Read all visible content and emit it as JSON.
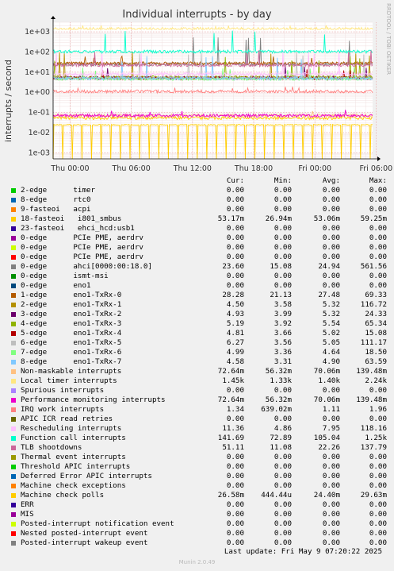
{
  "chart_data": {
    "type": "line",
    "title": "Individual interrupts - by day",
    "ylabel": "interrupts / second",
    "side_label": "RRDTOOL / TOBI OETIKER",
    "y_scale": "log",
    "ylim": [
      0.0005,
      3000
    ],
    "y_ticks": [
      "1e+03",
      "1e+02",
      "1e+01",
      "1e+00",
      "1e-01",
      "1e-02",
      "1e-03"
    ],
    "x_ticks": [
      "Thu 00:00",
      "Thu 06:00",
      "Thu 12:00",
      "Thu 18:00",
      "Fri 00:00",
      "Fri 06:00"
    ],
    "grid": true,
    "legend_columns": [
      "Cur:",
      "Min:",
      "Avg:",
      "Max:"
    ],
    "series": [
      {
        "name": "2-edge      timer",
        "color": "#00cc00",
        "cur": "0.00",
        "min": "0.00",
        "avg": "0.00",
        "max": "0.00"
      },
      {
        "name": "8-edge      rtc0",
        "color": "#0066b3",
        "cur": "0.00",
        "min": "0.00",
        "avg": "0.00",
        "max": "0.00"
      },
      {
        "name": "9-fasteoi   acpi",
        "color": "#ff8000",
        "cur": "0.00",
        "min": "0.00",
        "avg": "0.00",
        "max": "0.00"
      },
      {
        "name": "18-fasteoi   i801_smbus",
        "color": "#ffcc00",
        "cur": "53.17m",
        "min": "26.94m",
        "avg": "53.06m",
        "max": "59.25m"
      },
      {
        "name": "23-fasteoi   ehci_hcd:usb1",
        "color": "#330099",
        "cur": "0.00",
        "min": "0.00",
        "avg": "0.00",
        "max": "0.00"
      },
      {
        "name": "0-edge      PCIe PME, aerdrv",
        "color": "#990099",
        "cur": "0.00",
        "min": "0.00",
        "avg": "0.00",
        "max": "0.00"
      },
      {
        "name": "0-edge      PCIe PME, aerdrv",
        "color": "#ccff00",
        "cur": "0.00",
        "min": "0.00",
        "avg": "0.00",
        "max": "0.00"
      },
      {
        "name": "0-edge      PCIe PME, aerdrv",
        "color": "#ff0000",
        "cur": "0.00",
        "min": "0.00",
        "avg": "0.00",
        "max": "0.00"
      },
      {
        "name": "0-edge      ahci[0000:00:18.0]",
        "color": "#808080",
        "cur": "23.60",
        "min": "15.08",
        "avg": "24.94",
        "max": "561.56"
      },
      {
        "name": "0-edge      ismt-msi",
        "color": "#008f00",
        "cur": "0.00",
        "min": "0.00",
        "avg": "0.00",
        "max": "0.00"
      },
      {
        "name": "0-edge      eno1",
        "color": "#00487d",
        "cur": "0.00",
        "min": "0.00",
        "avg": "0.00",
        "max": "0.00"
      },
      {
        "name": "1-edge      eno1-TxRx-0",
        "color": "#b35a00",
        "cur": "28.28",
        "min": "21.13",
        "avg": "27.48",
        "max": "69.33"
      },
      {
        "name": "2-edge      eno1-TxRx-1",
        "color": "#b38f00",
        "cur": "4.50",
        "min": "3.58",
        "avg": "5.32",
        "max": "116.72"
      },
      {
        "name": "3-edge      eno1-TxRx-2",
        "color": "#6b006b",
        "cur": "4.93",
        "min": "3.99",
        "avg": "5.32",
        "max": "24.33"
      },
      {
        "name": "4-edge      eno1-TxRx-3",
        "color": "#8fb300",
        "cur": "5.19",
        "min": "3.92",
        "avg": "5.54",
        "max": "65.34"
      },
      {
        "name": "5-edge      eno1-TxRx-4",
        "color": "#b30000",
        "cur": "4.81",
        "min": "3.66",
        "avg": "5.02",
        "max": "15.08"
      },
      {
        "name": "6-edge      eno1-TxRx-5",
        "color": "#bebebe",
        "cur": "6.27",
        "min": "3.56",
        "avg": "5.05",
        "max": "111.17"
      },
      {
        "name": "7-edge      eno1-TxRx-6",
        "color": "#80ff80",
        "cur": "4.99",
        "min": "3.36",
        "avg": "4.64",
        "max": "18.50"
      },
      {
        "name": "8-edge      eno1-TxRx-7",
        "color": "#80c9ff",
        "cur": "4.58",
        "min": "3.31",
        "avg": "4.90",
        "max": "63.59"
      },
      {
        "name": "Non-maskable interrupts",
        "color": "#ffc080",
        "cur": "72.64m",
        "min": "56.32m",
        "avg": "70.06m",
        "max": "139.48m"
      },
      {
        "name": "Local timer interrupts",
        "color": "#ffe680",
        "cur": "1.45k",
        "min": "1.33k",
        "avg": "1.40k",
        "max": "2.24k"
      },
      {
        "name": "Spurious interrupts",
        "color": "#aa80ff",
        "cur": "0.00",
        "min": "0.00",
        "avg": "0.00",
        "max": "0.00"
      },
      {
        "name": "Performance monitoring interrupts",
        "color": "#ee00cc",
        "cur": "72.64m",
        "min": "56.32m",
        "avg": "70.06m",
        "max": "139.48m"
      },
      {
        "name": "IRQ work interrupts",
        "color": "#ff8080",
        "cur": "1.34",
        "min": "639.02m",
        "avg": "1.11",
        "max": "1.96"
      },
      {
        "name": "APIC ICR read retries",
        "color": "#666600",
        "cur": "0.00",
        "min": "0.00",
        "avg": "0.00",
        "max": "0.00"
      },
      {
        "name": "Rescheduling interrupts",
        "color": "#ffbfff",
        "cur": "11.36",
        "min": "4.86",
        "avg": "7.95",
        "max": "118.16"
      },
      {
        "name": "Function call interrupts",
        "color": "#00ffcc",
        "cur": "141.69",
        "min": "72.89",
        "avg": "105.04",
        "max": "1.25k"
      },
      {
        "name": "TLB shootdowns",
        "color": "#cc6699",
        "cur": "51.11",
        "min": "11.08",
        "avg": "22.26",
        "max": "137.79"
      },
      {
        "name": "Thermal event interrupts",
        "color": "#999900",
        "cur": "0.00",
        "min": "0.00",
        "avg": "0.00",
        "max": "0.00"
      },
      {
        "name": "Threshold APIC interrupts",
        "color": "#00cc00",
        "cur": "0.00",
        "min": "0.00",
        "avg": "0.00",
        "max": "0.00"
      },
      {
        "name": "Deferred Error APIC interrupts",
        "color": "#0066b3",
        "cur": "0.00",
        "min": "0.00",
        "avg": "0.00",
        "max": "0.00"
      },
      {
        "name": "Machine check exceptions",
        "color": "#ff8000",
        "cur": "0.00",
        "min": "0.00",
        "avg": "0.00",
        "max": "0.00"
      },
      {
        "name": "Machine check polls",
        "color": "#ffcc00",
        "cur": "26.58m",
        "min": "444.44u",
        "avg": "24.40m",
        "max": "29.63m"
      },
      {
        "name": "ERR",
        "color": "#330099",
        "cur": "0.00",
        "min": "0.00",
        "avg": "0.00",
        "max": "0.00"
      },
      {
        "name": "MIS",
        "color": "#990099",
        "cur": "0.00",
        "min": "0.00",
        "avg": "0.00",
        "max": "0.00"
      },
      {
        "name": "Posted-interrupt notification event",
        "color": "#ccff00",
        "cur": "0.00",
        "min": "0.00",
        "avg": "0.00",
        "max": "0.00"
      },
      {
        "name": "Nested posted-interrupt event",
        "color": "#ff0000",
        "cur": "0.00",
        "min": "0.00",
        "avg": "0.00",
        "max": "0.00"
      },
      {
        "name": "Posted-interrupt wakeup event",
        "color": "#808080",
        "cur": "0.00",
        "min": "0.00",
        "avg": "0.00",
        "max": "0.00"
      }
    ]
  },
  "footer": {
    "last_update": "Last update:  Fri May  9 07:20:22 2025",
    "munin_version": "Munin 2.0.49"
  }
}
